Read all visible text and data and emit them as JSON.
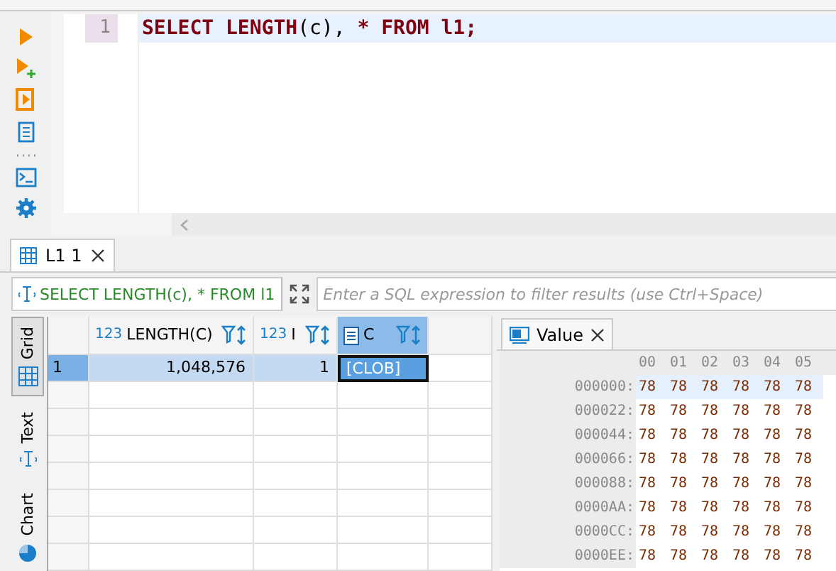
{
  "editor": {
    "lines": [
      {
        "number": "1",
        "current": true,
        "tokens": [
          {
            "text": "SELECT LENGTH",
            "kind": "keyword"
          },
          {
            "text": "(c), ",
            "kind": "plain"
          },
          {
            "text": "* FROM l1;",
            "kind": "keyword"
          }
        ]
      }
    ]
  },
  "results_tab": {
    "label": "L1 1",
    "selected": true
  },
  "filter": {
    "query": "SELECT LENGTH(c), * FROM l1",
    "placeholder": "Enter a SQL expression to filter results (use Ctrl+Space)"
  },
  "side_tabs": [
    {
      "label": "Grid",
      "kind": "grid",
      "selected": true
    },
    {
      "label": "Text",
      "kind": "text",
      "selected": false
    },
    {
      "label": "Chart",
      "kind": "chart",
      "selected": false
    }
  ],
  "grid": {
    "columns": [
      {
        "label": "LENGTH(C)",
        "kind": "number",
        "type_label": "123",
        "selected": false
      },
      {
        "label": "I",
        "kind": "number",
        "type_label": "123",
        "selected": false
      },
      {
        "label": "C",
        "kind": "text",
        "selected": true
      }
    ],
    "rows": [
      {
        "number": "1",
        "selected": true,
        "cells": [
          {
            "value": "1,048,576",
            "focused": false
          },
          {
            "value": "1",
            "focused": false
          },
          {
            "value": "[CLOB]",
            "focused": true
          }
        ]
      }
    ]
  },
  "value_panel": {
    "tab": {
      "label": "Value",
      "selected": true
    },
    "header": [
      "00",
      "01",
      "02",
      "03",
      "04",
      "05"
    ],
    "rows": [
      {
        "address": "000000:",
        "selected": true,
        "bytes": [
          "78",
          "78",
          "78",
          "78",
          "78",
          "78"
        ]
      },
      {
        "address": "000022:",
        "selected": false,
        "bytes": [
          "78",
          "78",
          "78",
          "78",
          "78",
          "78"
        ]
      },
      {
        "address": "000044:",
        "selected": false,
        "bytes": [
          "78",
          "78",
          "78",
          "78",
          "78",
          "78"
        ]
      },
      {
        "address": "000066:",
        "selected": false,
        "bytes": [
          "78",
          "78",
          "78",
          "78",
          "78",
          "78"
        ]
      },
      {
        "address": "000088:",
        "selected": false,
        "bytes": [
          "78",
          "78",
          "78",
          "78",
          "78",
          "78"
        ]
      },
      {
        "address": "0000AA:",
        "selected": false,
        "bytes": [
          "78",
          "78",
          "78",
          "78",
          "78",
          "78"
        ]
      },
      {
        "address": "0000CC:",
        "selected": false,
        "bytes": [
          "78",
          "78",
          "78",
          "78",
          "78",
          "78"
        ]
      },
      {
        "address": "0000EE:",
        "selected": false,
        "bytes": [
          "78",
          "78",
          "78",
          "78",
          "78",
          "78"
        ]
      }
    ]
  }
}
